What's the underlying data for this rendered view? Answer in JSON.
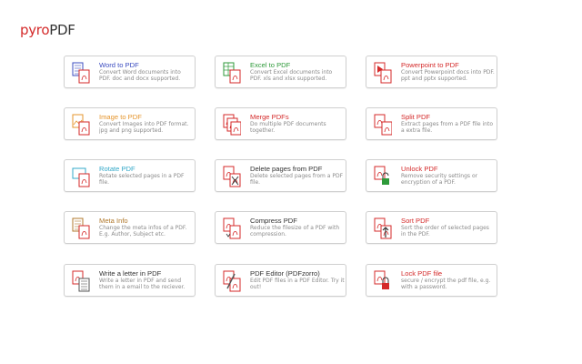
{
  "app": {
    "logo_part1": "pyro",
    "logo_part2": "PDF"
  },
  "colors": {
    "word": "#3b4cc0",
    "excel": "#2e9a3a",
    "red": "#d42a2a",
    "orange": "#e5952c",
    "cyan": "#33a8c8",
    "brown": "#b0782c",
    "dark": "#333333"
  },
  "tools": [
    {
      "title": "Word to PDF",
      "desc": "Convert Word documents into PDF. doc and docx supported.",
      "icon": "word-to-pdf-icon",
      "color": "#3b4cc0"
    },
    {
      "title": "Excel to PDF",
      "desc": "Convert Excel documents into PDF. xls and xlsx supported.",
      "icon": "excel-to-pdf-icon",
      "color": "#2e9a3a"
    },
    {
      "title": "Powerpoint to PDF",
      "desc": "Convert Powerpoint docs into PDF. ppt and pptx supported.",
      "icon": "powerpoint-to-pdf-icon",
      "color": "#d42a2a"
    },
    {
      "title": "Image to PDF",
      "desc": "Convert Images into PDF format. jpg and png supported.",
      "icon": "image-to-pdf-icon",
      "color": "#e5952c"
    },
    {
      "title": "Merge PDFs",
      "desc": "Do multiple PDF documents together.",
      "icon": "merge-pdfs-icon",
      "color": "#d42a2a"
    },
    {
      "title": "Split PDF",
      "desc": "Extract pages from a PDF file into a extra file.",
      "icon": "split-pdf-icon",
      "color": "#d42a2a"
    },
    {
      "title": "Rotate PDF",
      "desc": "Rotate selected pages in a PDF file.",
      "icon": "rotate-pdf-icon",
      "color": "#33a8c8"
    },
    {
      "title": "Delete pages from PDF",
      "desc": "Delete selected pages from a PDF file.",
      "icon": "delete-pages-icon",
      "color": "#333333"
    },
    {
      "title": "Unlock PDF",
      "desc": "Remove security settings or encryption of a PDF.",
      "icon": "unlock-pdf-icon",
      "color": "#d42a2a"
    },
    {
      "title": "Meta Info",
      "desc": "Change the meta infos of a PDF. E.g. Author, Subject etc.",
      "icon": "meta-info-icon",
      "color": "#b0782c"
    },
    {
      "title": "Compress PDF",
      "desc": "Reduce the filesize of a PDF with compression.",
      "icon": "compress-pdf-icon",
      "color": "#333333"
    },
    {
      "title": "Sort PDF",
      "desc": "Sort the order of selected pages in the PDF.",
      "icon": "sort-pdf-icon",
      "color": "#d42a2a"
    },
    {
      "title": "Write a letter in PDF",
      "desc": "Write a letter in PDF and send them in a email to the reciever.",
      "icon": "write-letter-icon",
      "color": "#333333"
    },
    {
      "title": "PDF Editor (PDFzorro)",
      "desc": "Edit PDF files in a PDF Editor. Try it out!",
      "icon": "pdf-editor-icon",
      "color": "#333333"
    },
    {
      "title": "Lock PDF file",
      "desc": "secure / encrypt the pdf file, e.g. with a password.",
      "icon": "lock-pdf-icon",
      "color": "#d42a2a"
    }
  ]
}
